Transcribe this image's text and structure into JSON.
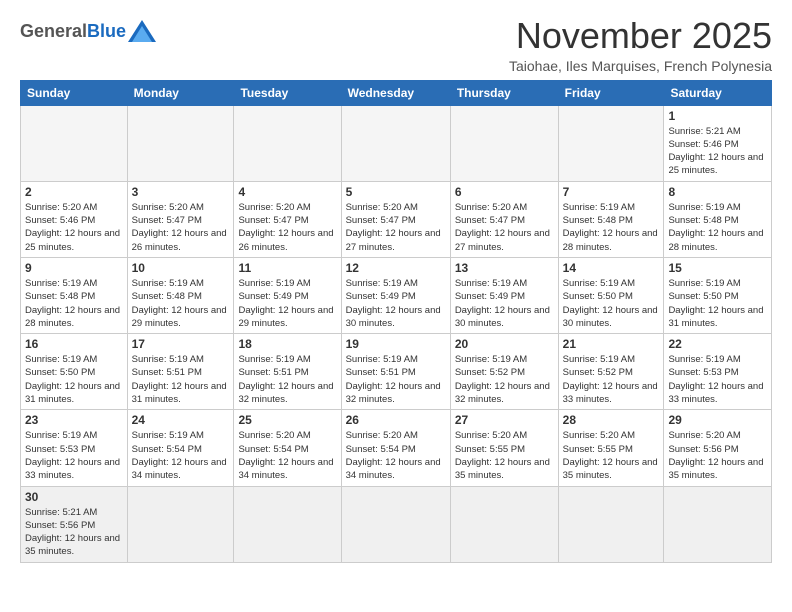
{
  "logo": {
    "general": "General",
    "blue": "Blue"
  },
  "title": "November 2025",
  "subtitle": "Taiohae, Iles Marquises, French Polynesia",
  "days_of_week": [
    "Sunday",
    "Monday",
    "Tuesday",
    "Wednesday",
    "Thursday",
    "Friday",
    "Saturday"
  ],
  "weeks": [
    [
      {
        "day": "",
        "info": ""
      },
      {
        "day": "",
        "info": ""
      },
      {
        "day": "",
        "info": ""
      },
      {
        "day": "",
        "info": ""
      },
      {
        "day": "",
        "info": ""
      },
      {
        "day": "",
        "info": ""
      },
      {
        "day": "1",
        "info": "Sunrise: 5:21 AM\nSunset: 5:46 PM\nDaylight: 12 hours and 25 minutes."
      }
    ],
    [
      {
        "day": "2",
        "info": "Sunrise: 5:20 AM\nSunset: 5:46 PM\nDaylight: 12 hours and 25 minutes."
      },
      {
        "day": "3",
        "info": "Sunrise: 5:20 AM\nSunset: 5:47 PM\nDaylight: 12 hours and 26 minutes."
      },
      {
        "day": "4",
        "info": "Sunrise: 5:20 AM\nSunset: 5:47 PM\nDaylight: 12 hours and 26 minutes."
      },
      {
        "day": "5",
        "info": "Sunrise: 5:20 AM\nSunset: 5:47 PM\nDaylight: 12 hours and 27 minutes."
      },
      {
        "day": "6",
        "info": "Sunrise: 5:20 AM\nSunset: 5:47 PM\nDaylight: 12 hours and 27 minutes."
      },
      {
        "day": "7",
        "info": "Sunrise: 5:19 AM\nSunset: 5:48 PM\nDaylight: 12 hours and 28 minutes."
      },
      {
        "day": "8",
        "info": "Sunrise: 5:19 AM\nSunset: 5:48 PM\nDaylight: 12 hours and 28 minutes."
      }
    ],
    [
      {
        "day": "9",
        "info": "Sunrise: 5:19 AM\nSunset: 5:48 PM\nDaylight: 12 hours and 28 minutes."
      },
      {
        "day": "10",
        "info": "Sunrise: 5:19 AM\nSunset: 5:48 PM\nDaylight: 12 hours and 29 minutes."
      },
      {
        "day": "11",
        "info": "Sunrise: 5:19 AM\nSunset: 5:49 PM\nDaylight: 12 hours and 29 minutes."
      },
      {
        "day": "12",
        "info": "Sunrise: 5:19 AM\nSunset: 5:49 PM\nDaylight: 12 hours and 30 minutes."
      },
      {
        "day": "13",
        "info": "Sunrise: 5:19 AM\nSunset: 5:49 PM\nDaylight: 12 hours and 30 minutes."
      },
      {
        "day": "14",
        "info": "Sunrise: 5:19 AM\nSunset: 5:50 PM\nDaylight: 12 hours and 30 minutes."
      },
      {
        "day": "15",
        "info": "Sunrise: 5:19 AM\nSunset: 5:50 PM\nDaylight: 12 hours and 31 minutes."
      }
    ],
    [
      {
        "day": "16",
        "info": "Sunrise: 5:19 AM\nSunset: 5:50 PM\nDaylight: 12 hours and 31 minutes."
      },
      {
        "day": "17",
        "info": "Sunrise: 5:19 AM\nSunset: 5:51 PM\nDaylight: 12 hours and 31 minutes."
      },
      {
        "day": "18",
        "info": "Sunrise: 5:19 AM\nSunset: 5:51 PM\nDaylight: 12 hours and 32 minutes."
      },
      {
        "day": "19",
        "info": "Sunrise: 5:19 AM\nSunset: 5:51 PM\nDaylight: 12 hours and 32 minutes."
      },
      {
        "day": "20",
        "info": "Sunrise: 5:19 AM\nSunset: 5:52 PM\nDaylight: 12 hours and 32 minutes."
      },
      {
        "day": "21",
        "info": "Sunrise: 5:19 AM\nSunset: 5:52 PM\nDaylight: 12 hours and 33 minutes."
      },
      {
        "day": "22",
        "info": "Sunrise: 5:19 AM\nSunset: 5:53 PM\nDaylight: 12 hours and 33 minutes."
      }
    ],
    [
      {
        "day": "23",
        "info": "Sunrise: 5:19 AM\nSunset: 5:53 PM\nDaylight: 12 hours and 33 minutes."
      },
      {
        "day": "24",
        "info": "Sunrise: 5:19 AM\nSunset: 5:54 PM\nDaylight: 12 hours and 34 minutes."
      },
      {
        "day": "25",
        "info": "Sunrise: 5:20 AM\nSunset: 5:54 PM\nDaylight: 12 hours and 34 minutes."
      },
      {
        "day": "26",
        "info": "Sunrise: 5:20 AM\nSunset: 5:54 PM\nDaylight: 12 hours and 34 minutes."
      },
      {
        "day": "27",
        "info": "Sunrise: 5:20 AM\nSunset: 5:55 PM\nDaylight: 12 hours and 35 minutes."
      },
      {
        "day": "28",
        "info": "Sunrise: 5:20 AM\nSunset: 5:55 PM\nDaylight: 12 hours and 35 minutes."
      },
      {
        "day": "29",
        "info": "Sunrise: 5:20 AM\nSunset: 5:56 PM\nDaylight: 12 hours and 35 minutes."
      }
    ],
    [
      {
        "day": "30",
        "info": "Sunrise: 5:21 AM\nSunset: 5:56 PM\nDaylight: 12 hours and 35 minutes."
      },
      {
        "day": "",
        "info": ""
      },
      {
        "day": "",
        "info": ""
      },
      {
        "day": "",
        "info": ""
      },
      {
        "day": "",
        "info": ""
      },
      {
        "day": "",
        "info": ""
      },
      {
        "day": "",
        "info": ""
      }
    ]
  ]
}
